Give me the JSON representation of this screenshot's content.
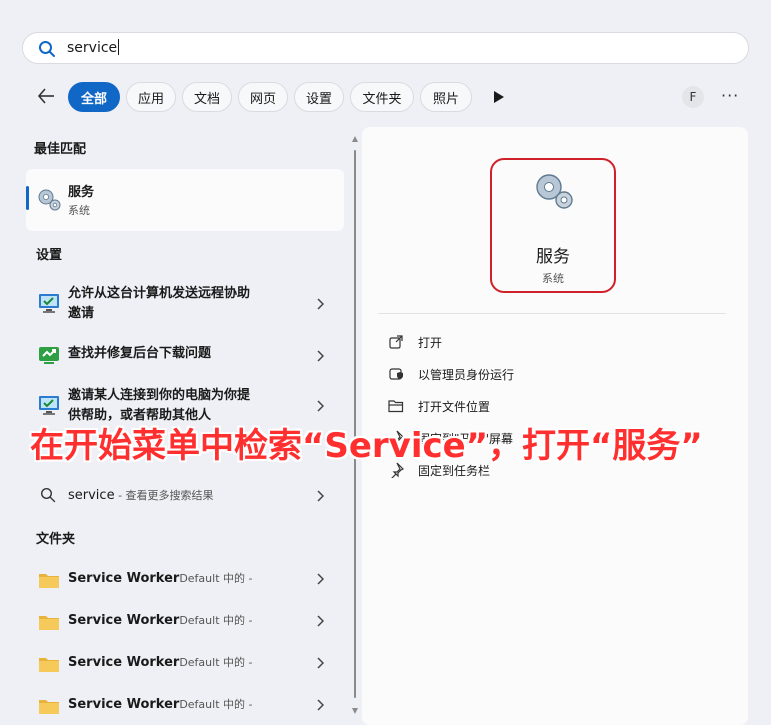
{
  "search": {
    "query": "service"
  },
  "filters": {
    "tabs": [
      {
        "label": "全部",
        "active": true
      },
      {
        "label": "应用"
      },
      {
        "label": "文档"
      },
      {
        "label": "网页"
      },
      {
        "label": "设置"
      },
      {
        "label": "文件夹"
      },
      {
        "label": "照片"
      }
    ],
    "avatar_letter": "F",
    "more_label": "···"
  },
  "best_match": {
    "section": "最佳匹配",
    "title": "服务",
    "subtitle": "系统"
  },
  "settings": {
    "section": "设置",
    "items": [
      {
        "line1": "允许从这台计算机发送远程协助",
        "line2": "邀请"
      },
      {
        "line1": "查找并修复后台下载问题"
      },
      {
        "line1": "邀请某人连接到你的电脑为你提",
        "line2": "供帮助，或者帮助其他人"
      }
    ]
  },
  "web": {
    "query": "service",
    "suffix": " - 查看更多搜索结果"
  },
  "folders": {
    "section": "文件夹",
    "items": [
      {
        "title": "Service Worker",
        "sub": "Default 中的 -"
      },
      {
        "title": "Service Worker",
        "sub": "Default 中的 -"
      },
      {
        "title": "Service Worker",
        "sub": "Default 中的 -"
      },
      {
        "title": "Service Worker",
        "sub": "Default 中的 -"
      }
    ]
  },
  "detail": {
    "title": "服务",
    "subtitle": "系统",
    "actions": [
      {
        "label": "打开",
        "icon": "open-external-icon"
      },
      {
        "label": "以管理员身份运行",
        "icon": "admin-shield-icon"
      },
      {
        "label": "打开文件位置",
        "icon": "folder-open-icon"
      },
      {
        "label": "固定到\"开始\"屏幕",
        "icon": "pin-icon"
      },
      {
        "label": "固定到任务栏",
        "icon": "pin-icon"
      }
    ]
  },
  "annotation": "在开始菜单中检索“Service”，打开“服务”",
  "colors": {
    "accent": "#1067c6",
    "highlight": "#d0202a",
    "annotation": "#ff2f2f"
  }
}
